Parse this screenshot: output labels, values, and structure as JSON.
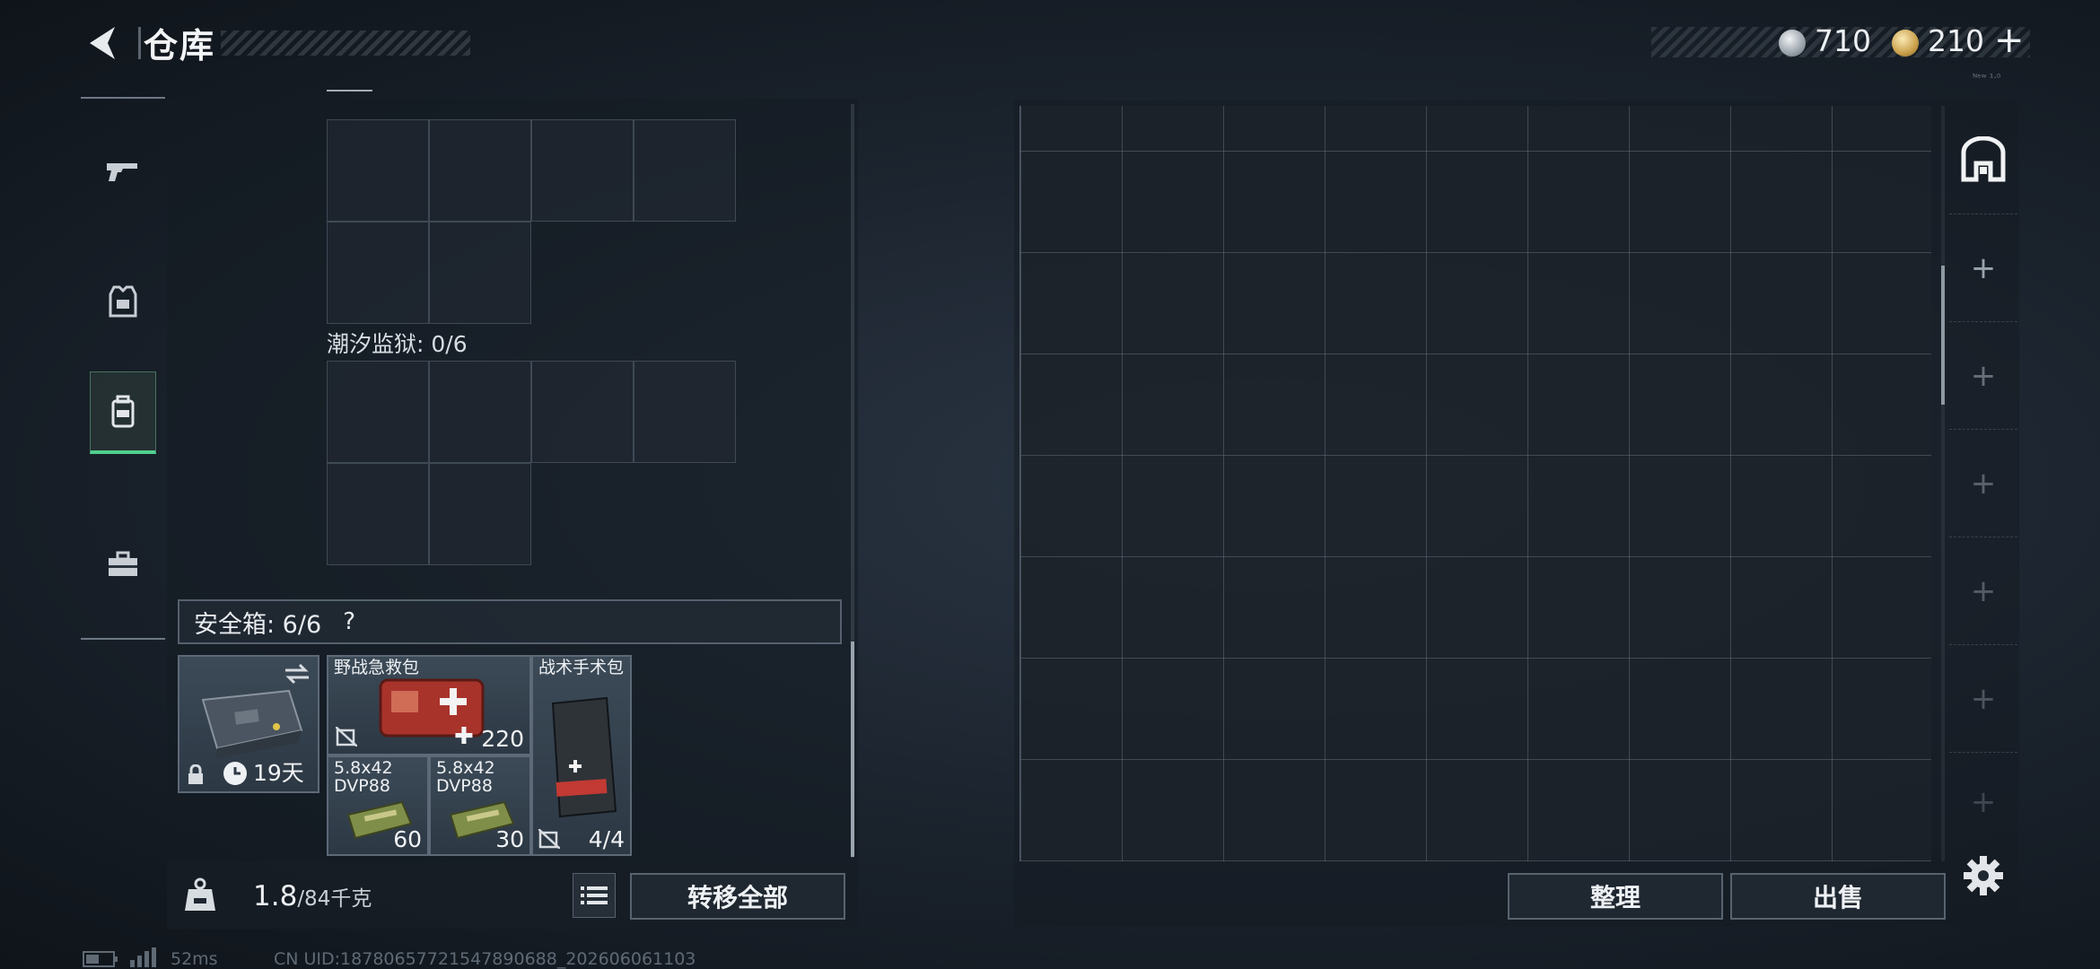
{
  "header": {
    "title": "仓库",
    "currency_silver": "710",
    "currency_gold": "210",
    "currency_add": "+",
    "tiny_text": "ᴺᵉʷ ¹·⁰"
  },
  "nav": {
    "categories": [
      {
        "name": "weapons",
        "icon": "pistol-icon"
      },
      {
        "name": "armor",
        "icon": "vest-icon"
      },
      {
        "name": "backpack",
        "icon": "backpack-icon",
        "active": true
      },
      {
        "name": "supplies",
        "icon": "toolbox-icon"
      }
    ]
  },
  "containers": {
    "section2_label": "潮汐监狱: 0/6",
    "safe_label": "安全箱: 6/6",
    "safe_help": "?"
  },
  "safe_box": {
    "timer": "19天",
    "items": [
      {
        "name": "野战急救包",
        "count": "220"
      },
      {
        "name": "战术手术包",
        "count": "4/4"
      },
      {
        "name": "5.8x42\nDVP88",
        "count": "60"
      },
      {
        "name": "5.8x42\nDVP88",
        "count": "30"
      }
    ]
  },
  "footer": {
    "weight_current": "1.8",
    "weight_max": "/84千克",
    "transfer_all": "转移全部",
    "sort": "整理",
    "sell": "出售"
  },
  "status_bar": {
    "ping": "52ms",
    "uid": "CN UID:18780657721547890688_202606061103"
  },
  "colors": {
    "accent_green": "#4fcf8e",
    "panel": "#1b232c",
    "grid_line": "#5f6a76"
  }
}
